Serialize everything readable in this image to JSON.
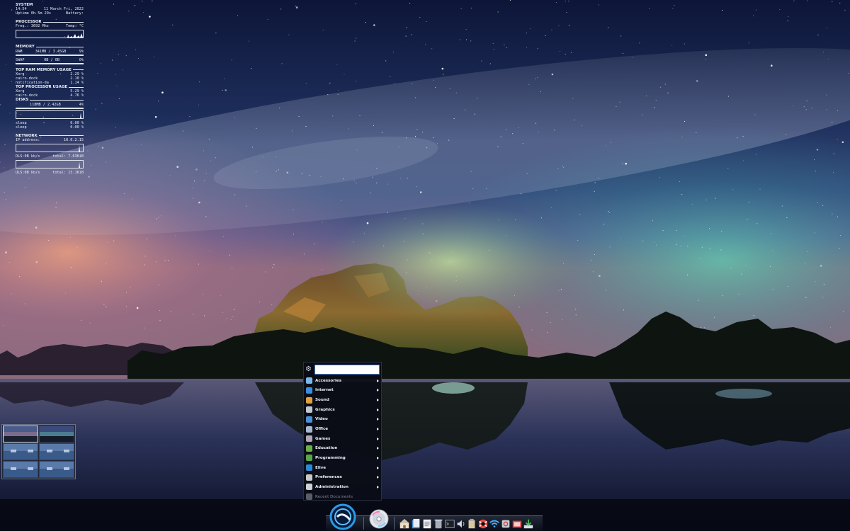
{
  "conky": {
    "system": {
      "title": "SYSTEM",
      "time": "14:54",
      "date": "11 March Fri, 2022",
      "uptime": "Uptime 0h 5m 29s",
      "battery": "Battery:"
    },
    "processor": {
      "title": "PROCESSOR",
      "freq": "Freq.: 3692 Mhz",
      "temp": "Temp: °C"
    },
    "memory": {
      "title": "MEMORY",
      "ram_label": "RAM",
      "ram_value": "341MB / 3.45GB",
      "ram_percent": "9%",
      "ram_fraction": 0.09,
      "swap_label": "SWAP",
      "swap_value": "0B / 0B",
      "swap_percent": "0%",
      "swap_fraction": 0.0
    },
    "top_ram": {
      "title": "TOP RAM MEMORY USAGE",
      "rows": [
        {
          "name": "Xorg",
          "value": "2.29 %"
        },
        {
          "name": "cairo-dock",
          "value": "2.10 %"
        },
        {
          "name": "notification-da",
          "value": "1.14 %"
        }
      ]
    },
    "top_cpu": {
      "title": "TOP PROCESSOR USAGE",
      "rows": [
        {
          "name": "Xorg",
          "value": "5.29 %"
        },
        {
          "name": "cairo-dock",
          "value": "4.76 %"
        }
      ]
    },
    "disks": {
      "title": "DISKS",
      "value": "118MB / 2.42GB",
      "percent": "4%",
      "fraction": 0.04,
      "rows": [
        {
          "name": "sleep",
          "value": "0.00 %"
        },
        {
          "name": "sleep",
          "value": "0.00 %"
        }
      ]
    },
    "network": {
      "title": "NETWORK",
      "ip_label": "IP address:",
      "ip_value": "10.0.2.15",
      "down_label": "DLS:0B   kb/s",
      "down_total": "total: 7.63KiB",
      "up_label": "ULS:0B   kb/s",
      "up_total": "total: 13.1KiB"
    }
  },
  "menu": {
    "search_value": "",
    "items": [
      {
        "label": "Accessories",
        "icon": "accessories-icon",
        "color": "#7ab8e8"
      },
      {
        "label": "Internet",
        "icon": "globe-icon",
        "color": "#3a8ee0"
      },
      {
        "label": "Sound",
        "icon": "sound-icon",
        "color": "#e0a040"
      },
      {
        "label": "Graphics",
        "icon": "graphics-icon",
        "color": "#c0c8d0"
      },
      {
        "label": "Video",
        "icon": "video-icon",
        "color": "#4a90d8"
      },
      {
        "label": "Office",
        "icon": "office-icon",
        "color": "#a8b8d0"
      },
      {
        "label": "Games",
        "icon": "games-icon",
        "color": "#b0a8b8"
      },
      {
        "label": "Education",
        "icon": "education-icon",
        "color": "#6ab04a"
      },
      {
        "label": "Programming",
        "icon": "programming-icon",
        "color": "#58a848"
      },
      {
        "label": "Elive",
        "icon": "elive-icon",
        "color": "#2a8ad8"
      },
      {
        "label": "Preferences",
        "icon": "preferences-icon",
        "color": "#c8c8c8"
      },
      {
        "label": "Administration",
        "icon": "administration-icon",
        "color": "#d0d0d8"
      },
      {
        "label": "Recent Documents",
        "icon": "recent-icon",
        "color": "#5a5e6a"
      }
    ]
  },
  "dock": {
    "items": [
      {
        "name": "home-folder-icon"
      },
      {
        "name": "file-manager-icon"
      },
      {
        "name": "text-editor-icon"
      },
      {
        "name": "trash-icon"
      },
      {
        "name": "terminal-icon"
      },
      {
        "name": "volume-icon"
      },
      {
        "name": "clipboard-icon"
      },
      {
        "name": "help-lifebuoy-icon"
      },
      {
        "name": "wifi-icon"
      },
      {
        "name": "shutdown-icon"
      },
      {
        "name": "screenshot-icon"
      },
      {
        "name": "download-icon"
      }
    ]
  }
}
